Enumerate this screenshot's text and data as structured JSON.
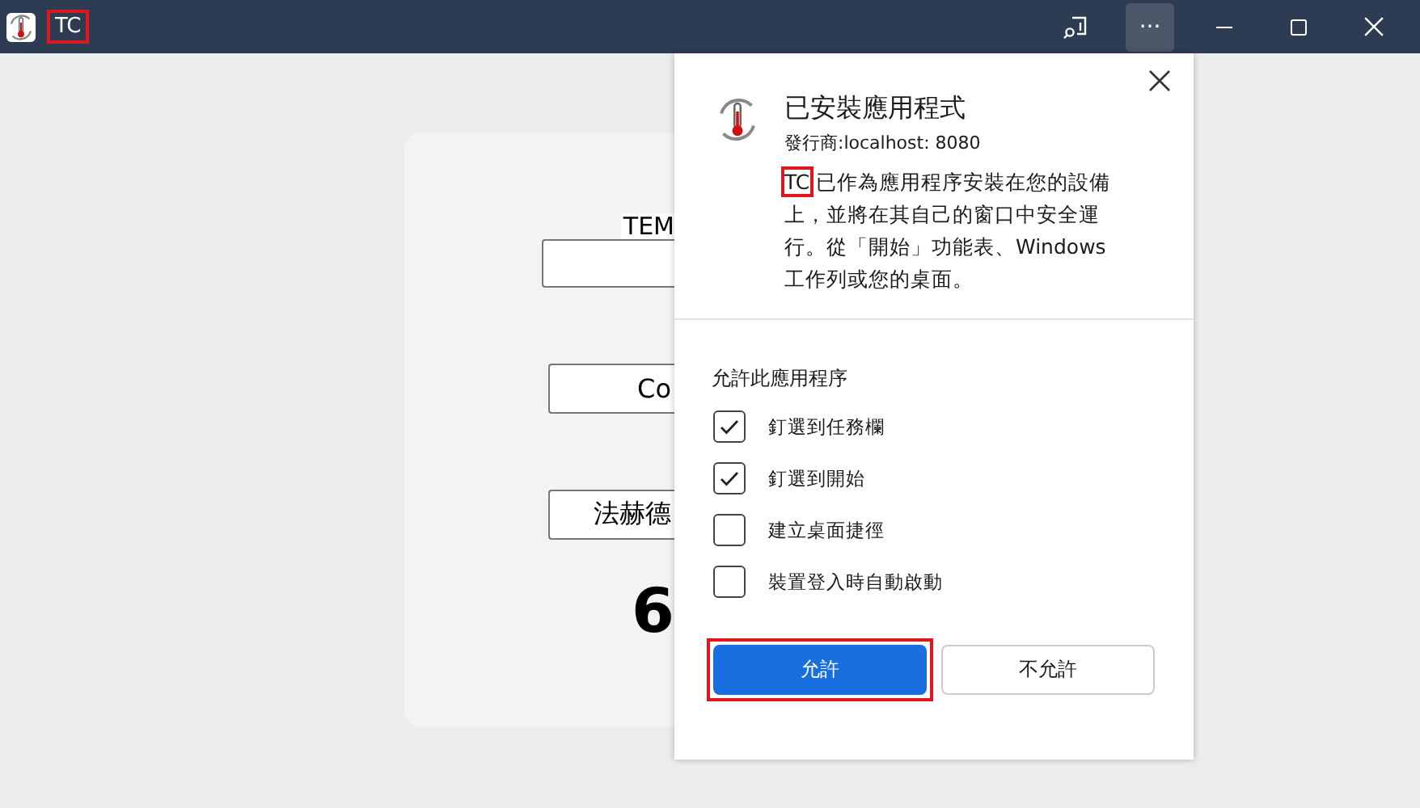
{
  "window": {
    "title": "TC",
    "title_highlighted": true,
    "more_button_active": true,
    "more_label": "···"
  },
  "app": {
    "label": "TEM",
    "buttons": [
      "Co",
      "法赫德"
    ],
    "result": "6"
  },
  "dialog": {
    "title": "已安裝應用程式",
    "publisher_label": "發行商:",
    "publisher": "localhost: 8080",
    "app_name": "TC",
    "app_name_highlighted": true,
    "description": "已作為應用程序安裝在您的設備上，並將在其自己的窗口中安全運行。從「開始」功能表、Windows 工作列或您的桌面。",
    "permissions_heading": "允許此應用程序",
    "options": [
      {
        "label": "釘選到任務欄",
        "checked": true
      },
      {
        "label": "釘選到開始",
        "checked": true
      },
      {
        "label": "建立桌面捷徑",
        "checked": false
      },
      {
        "label": "裝置登入時自動啟動",
        "checked": false
      }
    ],
    "buttons": [
      {
        "label": "允許",
        "kind": "primary",
        "highlighted": true
      },
      {
        "label": "不允許",
        "kind": "secondary",
        "highlighted": false
      }
    ]
  }
}
